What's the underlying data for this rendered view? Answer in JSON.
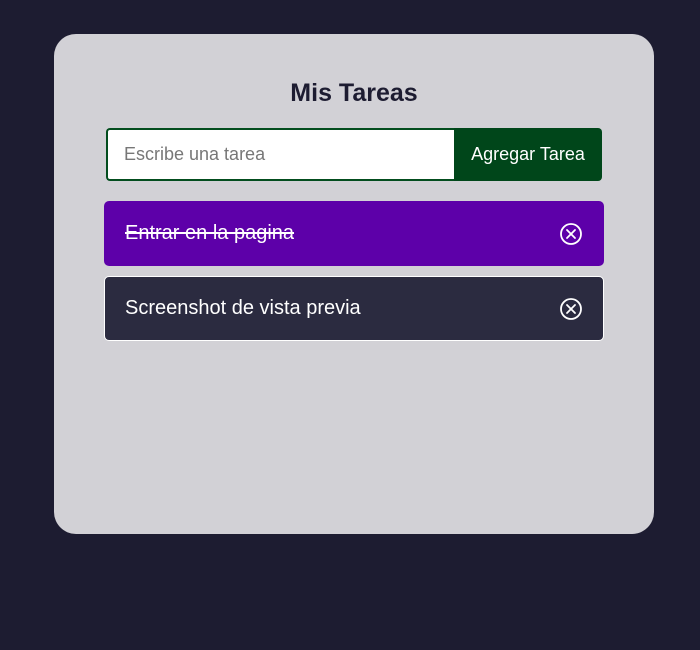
{
  "app": {
    "title": "Mis Tareas"
  },
  "form": {
    "input_value": "",
    "input_placeholder": "Escribe una tarea",
    "add_button_label": "Agregar Tarea"
  },
  "tasks": [
    {
      "text": "Entrar en la pagina",
      "completed": true,
      "delete_icon": "circle-x-icon"
    },
    {
      "text": "Screenshot de vista previa",
      "completed": false,
      "delete_icon": "circle-x-icon"
    }
  ],
  "colors": {
    "page_background": "#1d1c31",
    "card_background": "#d2d1d6",
    "accent_green": "#00461a",
    "completed_task": "#5d00a9",
    "pending_task": "#2b2b40"
  }
}
